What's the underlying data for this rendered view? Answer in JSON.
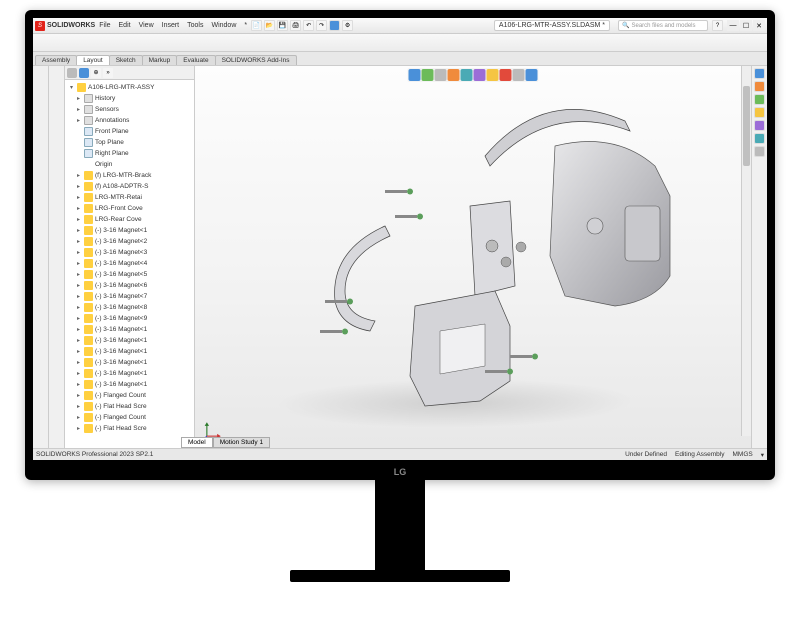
{
  "app": {
    "logo_text": "SOLIDWORKS",
    "doc_title": "A106-LRG-MTR-ASSY.SLDASM *"
  },
  "menu": [
    "File",
    "Edit",
    "View",
    "Insert",
    "Tools",
    "Window",
    "*"
  ],
  "search": {
    "placeholder": "Search files and models"
  },
  "ribbon_tabs": [
    "Assembly",
    "Layout",
    "Sketch",
    "Markup",
    "Evaluate",
    "SOLIDWORKS Add-Ins"
  ],
  "ribbon_active": 1,
  "tree": {
    "root": "A106-LRG-MTR-ASSY",
    "features": [
      {
        "icon": "feat",
        "label": "History"
      },
      {
        "icon": "feat",
        "label": "Sensors"
      },
      {
        "icon": "feat",
        "label": "Annotations"
      },
      {
        "icon": "plane",
        "label": "Front Plane"
      },
      {
        "icon": "plane",
        "label": "Top Plane"
      },
      {
        "icon": "plane",
        "label": "Right Plane"
      },
      {
        "icon": "origin",
        "label": "Origin"
      }
    ],
    "parts": [
      "(f) LRG-MTR-Brack",
      "(f) A108-ADPTR-S",
      "LRG-MTR-Retai",
      "LRG-Front Cove",
      "LRG-Rear Cove",
      "(-) 3-16 Magnet<1",
      "(-) 3-16 Magnet<2",
      "(-) 3-16 Magnet<3",
      "(-) 3-16 Magnet<4",
      "(-) 3-16 Magnet<5",
      "(-) 3-16 Magnet<6",
      "(-) 3-16 Magnet<7",
      "(-) 3-16 Magnet<8",
      "(-) 3-16 Magnet<9",
      "(-) 3-16 Magnet<1",
      "(-) 3-16 Magnet<1",
      "(-) 3-16 Magnet<1",
      "(-) 3-16 Magnet<1",
      "(-) 3-16 Magnet<1",
      "(-) 3-16 Magnet<1",
      "(-) Flanged Count",
      "(-) Flat Head Scre",
      "(-) Flanged Count",
      "(-) Flat Head Scre"
    ]
  },
  "bottom_tabs": [
    "Model",
    "Motion Study 1"
  ],
  "status": {
    "edition": "SOLIDWORKS Professional 2023 SP2.1",
    "state": "Under Defined",
    "mode": "Editing Assembly",
    "units": "MMGS"
  },
  "monitor_brand": "LG"
}
